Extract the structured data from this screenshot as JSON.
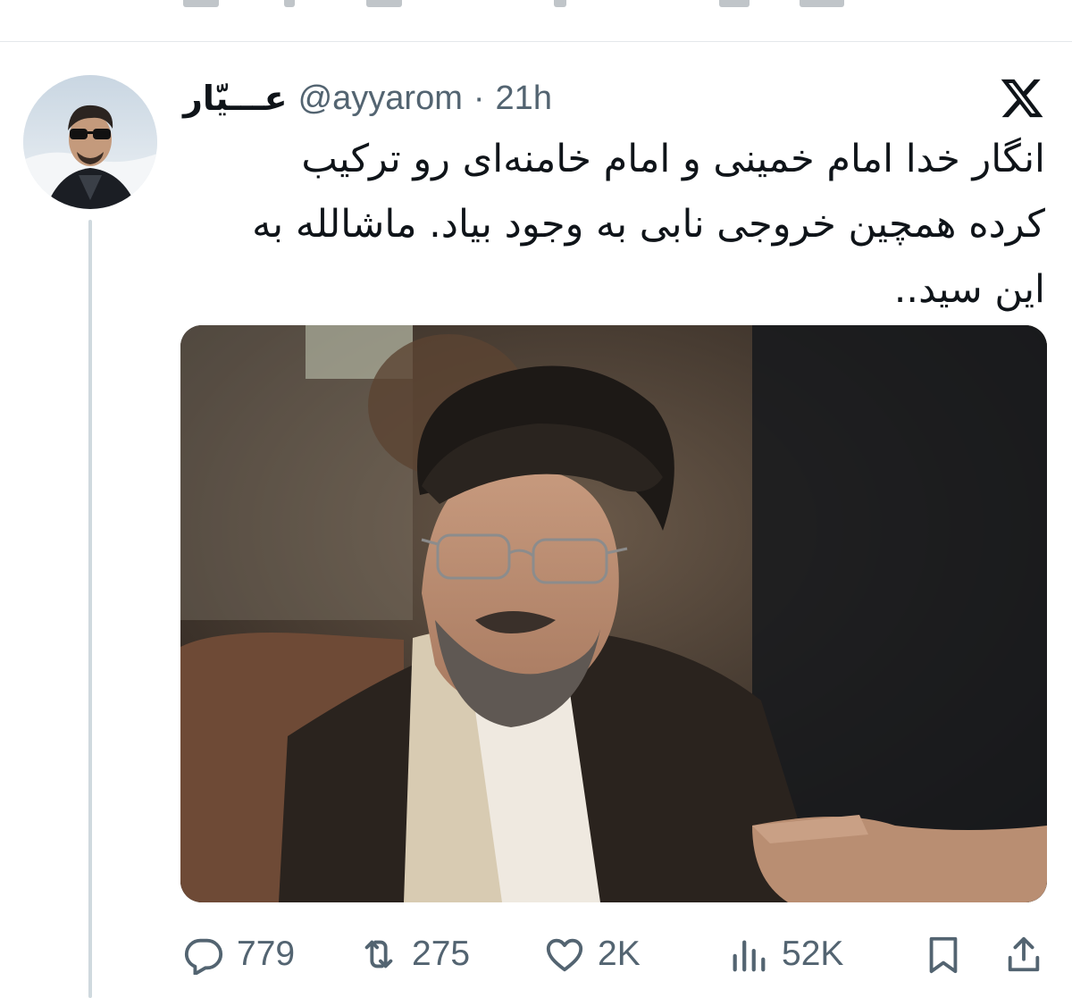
{
  "tweet": {
    "author": {
      "display_name": "عـــیّار",
      "handle": "@ayyarom",
      "separator": "·",
      "time": "21h"
    },
    "text_lines": [
      "انگار خدا امام خمینی و امام خامنه‌ای رو ترکیب",
      "کرده همچین خروجی نابی به وجود بیاد. ماشالله به",
      "این سید.."
    ],
    "stats": {
      "replies": "779",
      "reposts": "275",
      "likes": "2K",
      "views": "52K"
    }
  },
  "icons": {
    "brand": "x-logo-icon",
    "reply": "reply-icon",
    "repost": "repost-icon",
    "like": "heart-icon",
    "views": "views-icon",
    "bookmark": "bookmark-icon",
    "share": "share-icon"
  },
  "colors": {
    "text_primary": "#0f1419",
    "text_secondary": "#536471",
    "divider": "#e4e8eb",
    "thread_line": "#cfd9de"
  }
}
